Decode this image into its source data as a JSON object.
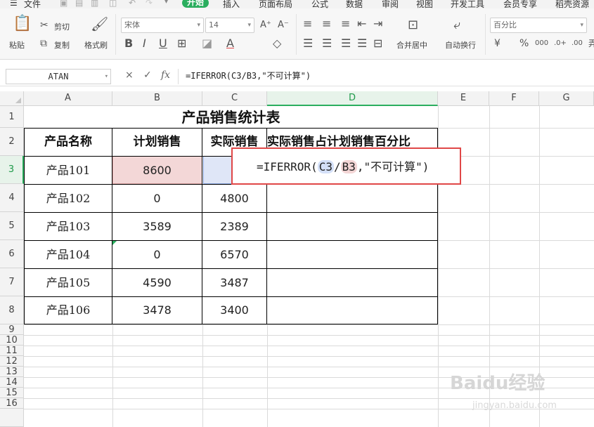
{
  "ribbon": {
    "tabs": [
      "文件",
      "开始",
      "插入",
      "页面布局",
      "公式",
      "数据",
      "审阅",
      "视图",
      "开发工具",
      "会员专享",
      "稻壳资源"
    ],
    "active_tab": "开始",
    "paste": "粘贴",
    "cut": "剪切",
    "copy": "复制",
    "format_painter": "格式刷",
    "font_name": "宋体",
    "font_size": "14",
    "merge_center": "合并居中",
    "wrap_text": "自动换行",
    "number_format": "百分比",
    "currency_symbol": "¥",
    "percent_symbol": "%"
  },
  "formula_bar": {
    "name_box": "ATAN",
    "cancel": "×",
    "confirm": "✓",
    "fx": "fx",
    "content": "=IFERROR(C3/B3,\"不可计算\")"
  },
  "grid": {
    "columns": [
      "A",
      "B",
      "C",
      "D",
      "E",
      "F",
      "G"
    ],
    "rows": [
      "1",
      "2",
      "3",
      "4",
      "5",
      "6",
      "7",
      "8",
      "9",
      "10",
      "11",
      "12",
      "13",
      "14",
      "15",
      "16"
    ],
    "selected_column": "D",
    "selected_row": "3"
  },
  "sheet": {
    "title": "产品销售统计表",
    "headers": [
      "产品名称",
      "计划销售",
      "实际销售",
      "实际销售占计划销售百分比"
    ],
    "rows": [
      {
        "name": "产品101",
        "plan": "8600",
        "actual": ""
      },
      {
        "name": "产品102",
        "plan": "0",
        "actual": "4800"
      },
      {
        "name": "产品103",
        "plan": "3589",
        "actual": "2389"
      },
      {
        "name": "产品104",
        "plan": "0",
        "actual": "6570"
      },
      {
        "name": "产品105",
        "plan": "4590",
        "actual": "3487"
      },
      {
        "name": "产品106",
        "plan": "3478",
        "actual": "3400"
      }
    ]
  },
  "formula_edit": {
    "prefix": "=IFERROR(",
    "ref1": "C3",
    "slash": "/",
    "ref2": "B3",
    "suffix": ",\"不可计算\")"
  },
  "watermark": {
    "brand": "Baidu经验",
    "url": "jingyan.baidu.com"
  },
  "colors": {
    "accent": "#2aae5e",
    "highlight_border": "#e04747",
    "ref_c": "#d4e0f8",
    "ref_b": "#f3d5d5"
  }
}
